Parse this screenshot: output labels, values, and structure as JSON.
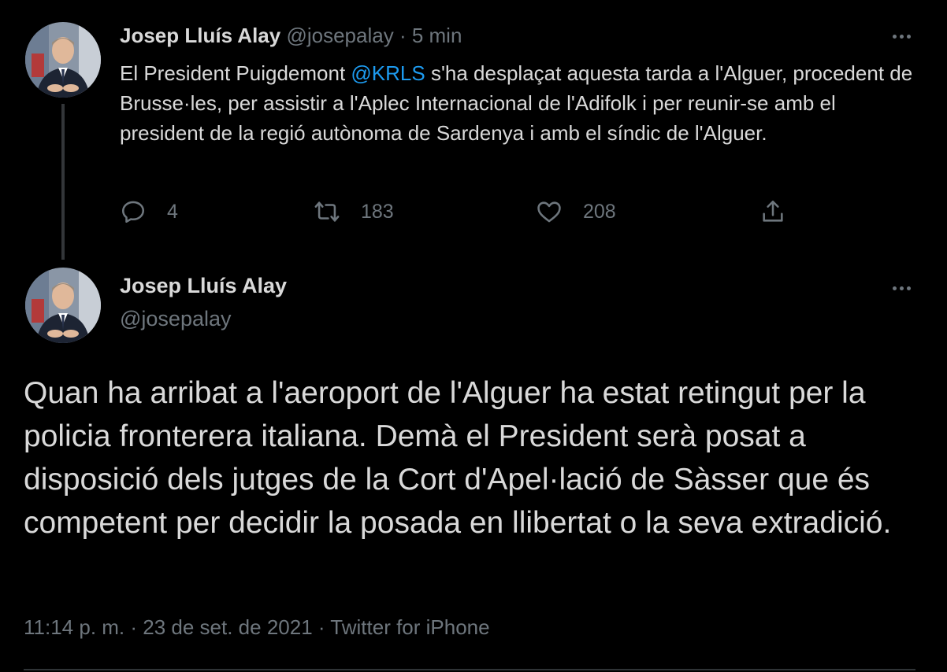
{
  "tweet1": {
    "author_name": "Josep Lluís Alay",
    "handle": "@josepalay",
    "separator": "·",
    "time": "5 min",
    "text_before": "El President Puigdemont ",
    "mention": "@KRLS",
    "text_after": " s'ha desplaçat aquesta tarda a l'Alguer, procedent de Brusse·les, per assistir a l'Aplec Internacional de l'Adifolk i per reunir-se amb el president de la regió autònoma de Sardenya i amb el síndic de l'Alguer.",
    "actions": {
      "reply_count": "4",
      "retweet_count": "183",
      "like_count": "208"
    }
  },
  "tweet2": {
    "author_name": "Josep Lluís Alay",
    "handle": "@josepalay",
    "text": "Quan ha arribat a l'aeroport de l'Alguer ha estat retingut per la policia fronterera italiana. Demà el President serà posat a disposició dels jutges de la Cort d'Apel·lació de Sàsser que és competent per decidir la posada en llibertat o la seva extradició.",
    "timestamp": "11:14 p. m. · 23 de set. de 2021 · Twitter for iPhone"
  },
  "colors": {
    "background": "#000000",
    "text": "#d9d9d9",
    "secondary": "#6e767d",
    "link": "#1d9bf0",
    "thread_line": "#333639"
  },
  "icons": {
    "reply": "reply-icon",
    "retweet": "retweet-icon",
    "like": "like-icon",
    "share": "share-icon",
    "more": "more-icon"
  }
}
